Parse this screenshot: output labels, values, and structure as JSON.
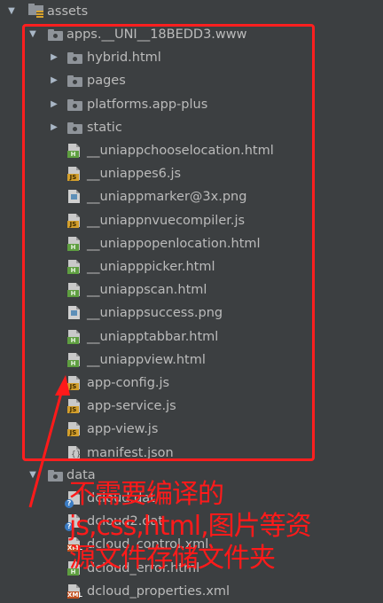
{
  "tree": {
    "assets": "assets",
    "apps_folder": "apps.__UNI__18BEDD3.www",
    "folders": [
      "hybrid.html",
      "pages",
      "platforms.app-plus",
      "static"
    ],
    "files": [
      {
        "name": "__uniappchooselocation.html",
        "type": "html"
      },
      {
        "name": "__uniappes6.js",
        "type": "js"
      },
      {
        "name": "__uniappmarker@3x.png",
        "type": "png"
      },
      {
        "name": "__uniappnvuecompiler.js",
        "type": "js"
      },
      {
        "name": "__uniappopenlocation.html",
        "type": "html"
      },
      {
        "name": "__uniapppicker.html",
        "type": "html"
      },
      {
        "name": "__uniappscan.html",
        "type": "html"
      },
      {
        "name": "__uniappsuccess.png",
        "type": "png"
      },
      {
        "name": "__uniapptabbar.html",
        "type": "html"
      },
      {
        "name": "__uniappview.html",
        "type": "html"
      },
      {
        "name": "app-config.js",
        "type": "js"
      },
      {
        "name": "app-service.js",
        "type": "js"
      },
      {
        "name": "app-view.js",
        "type": "js"
      },
      {
        "name": "manifest.json",
        "type": "json"
      }
    ],
    "data_folder": "data",
    "data_files": [
      {
        "name": "dcloud.dat",
        "type": "dat"
      },
      {
        "name": "dcloud2.dat",
        "type": "dat"
      },
      {
        "name": "dcloud_control.xml",
        "type": "xml"
      },
      {
        "name": "dcloud_error.html",
        "type": "html"
      },
      {
        "name": "dcloud_properties.xml",
        "type": "xml"
      }
    ]
  },
  "annotation": {
    "line1": "不需要编译的",
    "line2": "js,css,html,图片等资",
    "line3": "源文件存储文件夹"
  },
  "colors": {
    "background": "#3c3f41",
    "text": "#bbbbbb",
    "annotation": "#ff1a1a"
  }
}
